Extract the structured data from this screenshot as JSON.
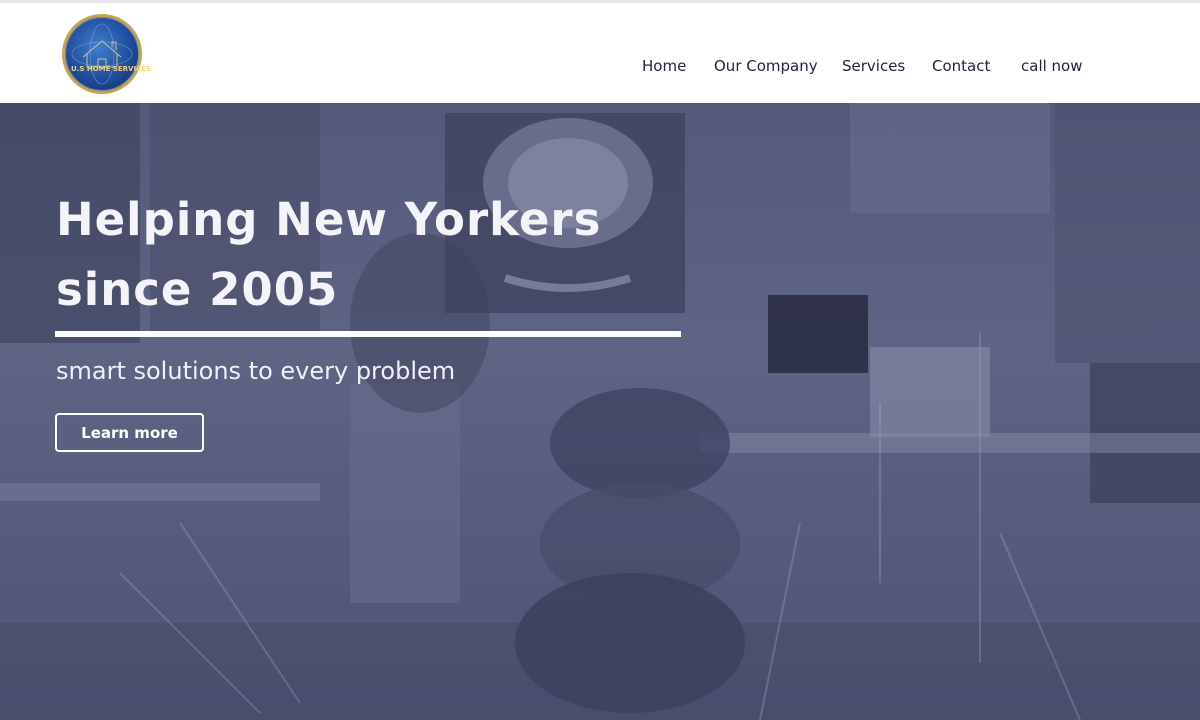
{
  "brand": {
    "logo_text": "U.S HOME SERVICES"
  },
  "nav": {
    "items": [
      {
        "label": "Home"
      },
      {
        "label": "Our Company"
      },
      {
        "label": "Services"
      },
      {
        "label": "Contact"
      },
      {
        "label": "call now"
      }
    ]
  },
  "hero": {
    "title_line1": "Helping New Yorkers",
    "title_line2": "since 2005",
    "subtitle": "smart solutions to every problem",
    "cta_label": "Learn more"
  },
  "colors": {
    "nav_text": "#1c2440",
    "hero_overlay": "#5a6082",
    "hero_text": "#f4f4f8"
  }
}
